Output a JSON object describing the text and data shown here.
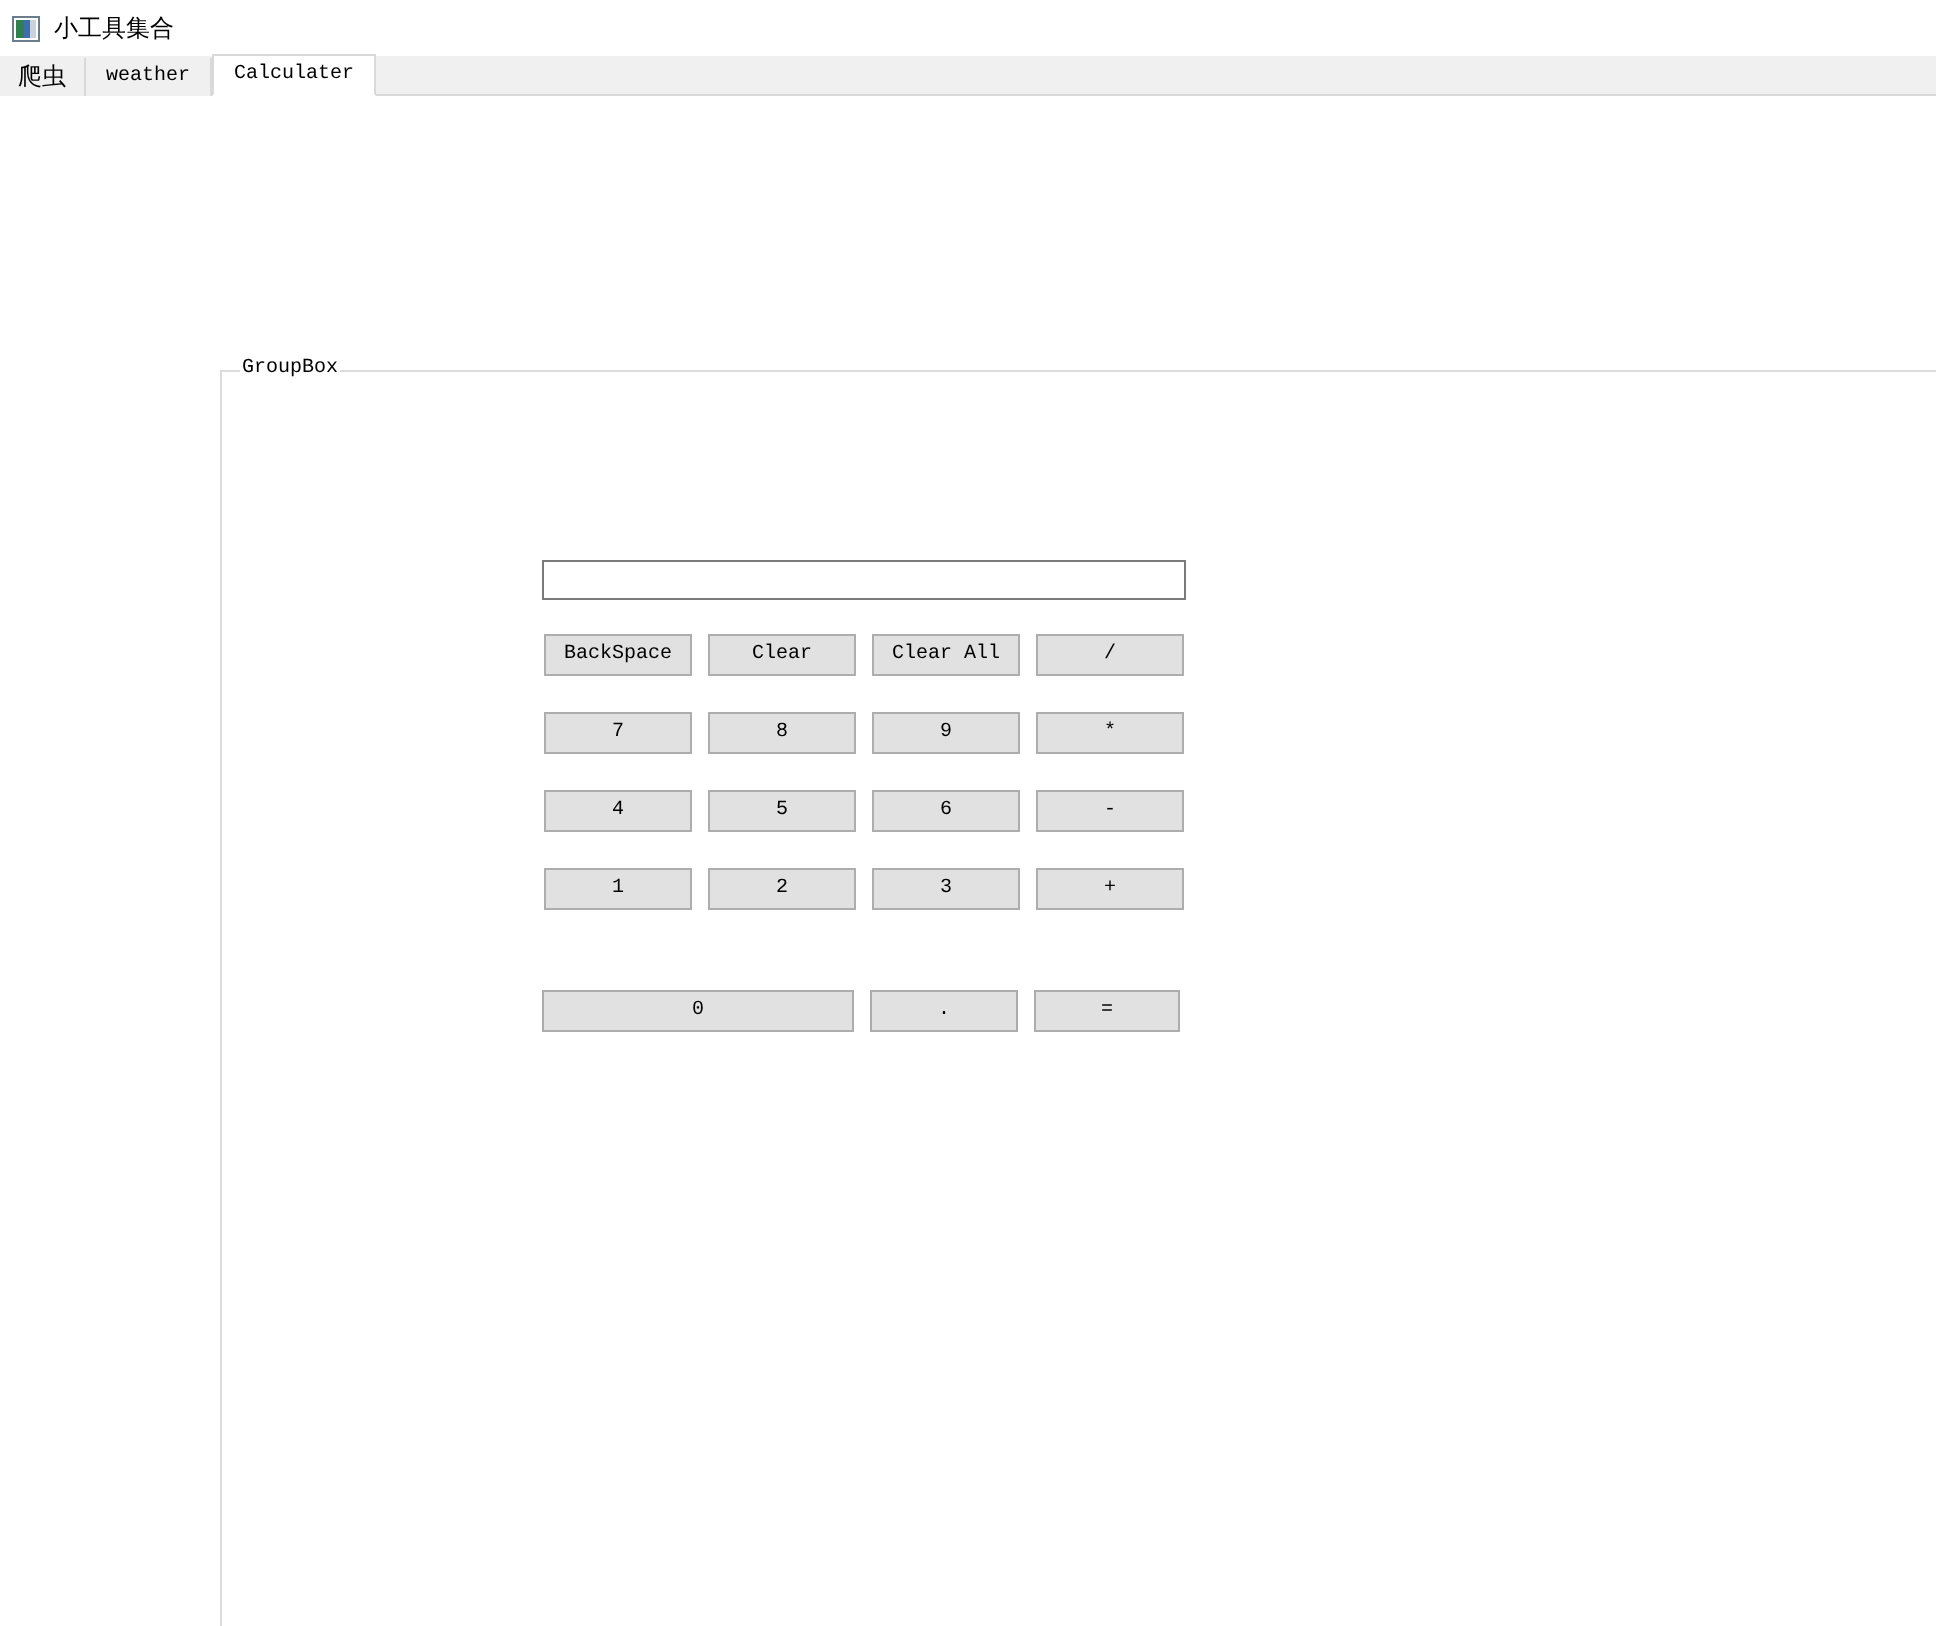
{
  "window": {
    "title": "小工具集合"
  },
  "tabs": [
    {
      "label": "爬虫",
      "selected": false
    },
    {
      "label": "weather",
      "selected": false
    },
    {
      "label": "Calculater",
      "selected": true
    }
  ],
  "group_box": {
    "title": "GroupBox"
  },
  "keypad": [
    [
      "BackSpace",
      "Clear",
      "Clear All",
      "/"
    ],
    [
      "7",
      "8",
      "9",
      "*"
    ],
    [
      "4",
      "5",
      "6",
      "-"
    ],
    [
      "1",
      "2",
      "3",
      "+"
    ]
  ],
  "bottom_row": [
    "0",
    ".",
    "="
  ]
}
